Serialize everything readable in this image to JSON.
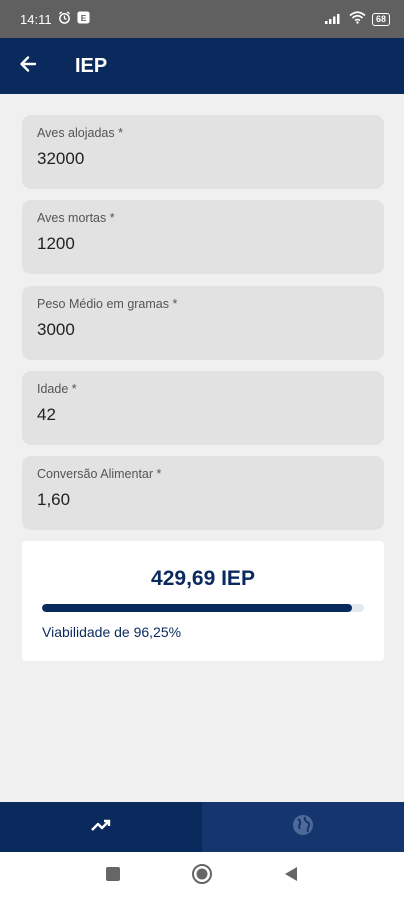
{
  "status": {
    "time": "14:11",
    "battery": "68"
  },
  "appbar": {
    "title": "IEP",
    "back_icon": "arrow-left-icon"
  },
  "fields": [
    {
      "label": "Aves alojadas *",
      "value": "32000"
    },
    {
      "label": "Aves mortas *",
      "value": "1200"
    },
    {
      "label": "Peso Médio em gramas *",
      "value": "3000"
    },
    {
      "label": "Idade *",
      "value": "42"
    },
    {
      "label": "Conversão Alimentar *",
      "value": "1,60"
    }
  ],
  "result": {
    "value_text": "429,69 IEP",
    "viability_text": "Viabilidade de 96,25%",
    "viability_fraction": 0.9625
  },
  "bottom_nav": [
    {
      "icon": "trending-up-icon",
      "active": true
    },
    {
      "icon": "globe-icon",
      "active": false
    }
  ],
  "colors": {
    "primary": "#0a2a5e",
    "background": "#f0f0f0",
    "field_bg": "#e2e2e2"
  }
}
